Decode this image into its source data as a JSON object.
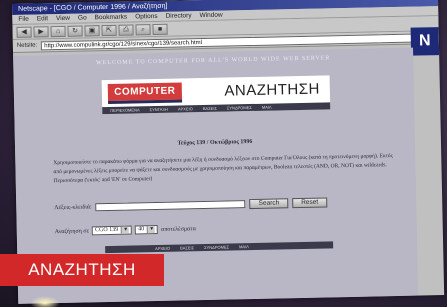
{
  "window": {
    "title": "Netscape - [CGO / Computer 1996 / Αναζήτηση]",
    "menu": [
      "File",
      "Edit",
      "View",
      "Go",
      "Bookmarks",
      "Options",
      "Directory",
      "Window"
    ],
    "address_label": "Netsite:",
    "url": "http://www.compulink.gr/cgo/129/sinex/cgo/139/search.html"
  },
  "page": {
    "welcome_banner": "WELCOME TO COMPUTER FOR ALL'S WORLD WIDE WEB SERVER",
    "logo_text": "COMPUTER",
    "search_title": "ΑΝΑΖΗΤΗΣΗ",
    "nav_top": [
      "ΠΕΡΙΕΧΟΜΕΝΑ",
      "ΣΥΝΤΑΞΗ",
      "ΑΡΧΕΙΟ",
      "ΒΑΣΕΙΣ",
      "ΣΥΝΔΡΟΜΕΣ",
      "ΜΑΙΛ"
    ],
    "issue": "Τεύχος 139 / Οκτώβριος 1996",
    "description": "Χρησιμοποιείστε το παρακάτω φόρμα για να αναζητήσετε μια λέξη ή συνδυασμό λέξεων στο Computer Για Όλους (κατά τη προτεινόμενη μορφή). Εκτός από μεμονωμένες λέξεις μπορείτε να ψάξετε και συνδυασμούς με χρησιμοποίηση και παραμέτρων, Boolean τελεστές (AND, OR, NOT) και wildcards. Περισσότερα ('εκτός' and 'ΕΝ' σε Computer)",
    "keyword_label": "Λέξεις-κλειδιά:",
    "search_btn": "Search",
    "reset_btn": "Reset",
    "scope_label": "Αναζήτηση σε",
    "issue_select": "CGO 139",
    "count_select": "40",
    "count_suffix": "αποτελέσματα",
    "nav_bottom": [
      "ΑΡΧΕΙΟ",
      "ΒΑΣΕΙΣ",
      "ΣΥΝΔΡΟΜΕΣ",
      "ΜΑΙΛ"
    ]
  },
  "overlay_caption": "ΑΝΑΖΗΤΗΣΗ",
  "colors": {
    "accent_red": "#d2282a",
    "titlebar": "#1e2a78",
    "page_bg": "#b9b6c6"
  }
}
